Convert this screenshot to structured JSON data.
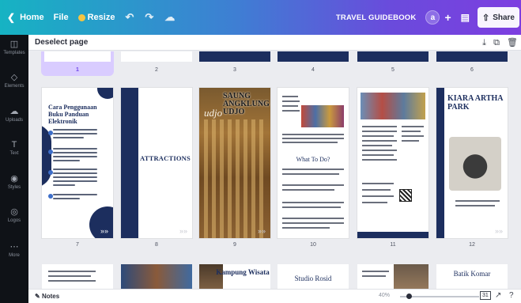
{
  "topbar": {
    "home": "Home",
    "file": "File",
    "resize": "Resize",
    "doc_title": "TRAVEL GUIDEBOOK",
    "avatar": "a",
    "share": "Share"
  },
  "sidebar": {
    "items": [
      {
        "label": "Templates",
        "icon": "grid-icon"
      },
      {
        "label": "Elements",
        "icon": "shapes-icon"
      },
      {
        "label": "Uploads",
        "icon": "cloud-upload-icon"
      },
      {
        "label": "Text",
        "icon": "text-icon"
      },
      {
        "label": "Styles",
        "icon": "palette-icon"
      },
      {
        "label": "Logos",
        "icon": "logo-icon"
      },
      {
        "label": "More",
        "icon": "more-icon"
      }
    ]
  },
  "toolbar": {
    "deselect": "Deselect page"
  },
  "pages": {
    "row1_numbers": [
      "1",
      "2",
      "3",
      "4",
      "5",
      "6"
    ],
    "row2_numbers": [
      "7",
      "8",
      "9",
      "10",
      "11",
      "12"
    ],
    "p7_title": "Cara Penggunaan Buku Panduan Elektronik",
    "p8_title": "ATTRACTIONS",
    "p9_title": "SAUNG ANGKLUNG UDJO",
    "p9_logo": "udjo",
    "p10_heading": "What To Do?",
    "p12_title": "KIARA ARTHA PARK",
    "row3_titles": [
      "Kampung Wisata",
      "Studio Rosid",
      "Batik Komar"
    ]
  },
  "bottombar": {
    "notes": "Notes",
    "zoom": "40%",
    "page_count": "31"
  },
  "colors": {
    "accent": "#6e44e8",
    "navy": "#1c2e5e"
  }
}
